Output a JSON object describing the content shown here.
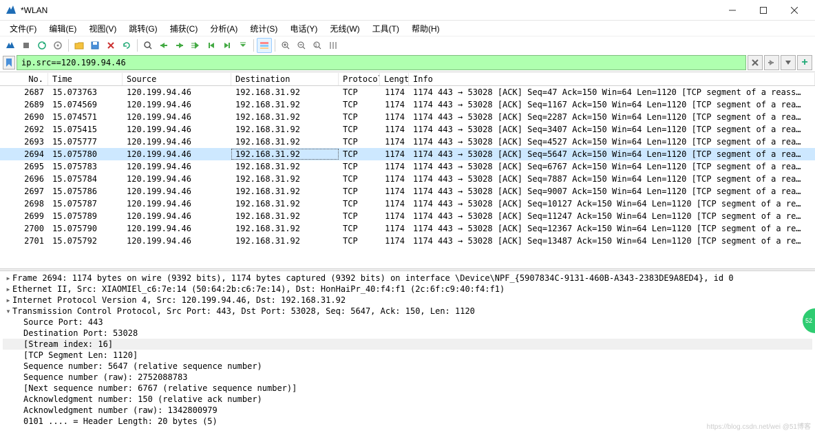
{
  "window": {
    "title": "*WLAN"
  },
  "menus": [
    "文件(F)",
    "编辑(E)",
    "视图(V)",
    "跳转(G)",
    "捕获(C)",
    "分析(A)",
    "统计(S)",
    "电话(Y)",
    "无线(W)",
    "工具(T)",
    "帮助(H)"
  ],
  "filter": {
    "value": "ip.src==120.199.94.46"
  },
  "columns": {
    "no": "No.",
    "time": "Time",
    "source": "Source",
    "destination": "Destination",
    "protocol": "Protocol",
    "length": "Length",
    "info": "Info"
  },
  "selected_no": 2694,
  "packets": [
    {
      "no": 2687,
      "time": "15.073763",
      "src": "120.199.94.46",
      "dst": "192.168.31.92",
      "proto": "TCP",
      "len": 1174,
      "info": "443 → 53028 [ACK] Seq=47 Ack=150 Win=64 Len=1120 [TCP segment of a reass…"
    },
    {
      "no": 2689,
      "time": "15.074569",
      "src": "120.199.94.46",
      "dst": "192.168.31.92",
      "proto": "TCP",
      "len": 1174,
      "info": "443 → 53028 [ACK] Seq=1167 Ack=150 Win=64 Len=1120 [TCP segment of a rea…"
    },
    {
      "no": 2690,
      "time": "15.074571",
      "src": "120.199.94.46",
      "dst": "192.168.31.92",
      "proto": "TCP",
      "len": 1174,
      "info": "443 → 53028 [ACK] Seq=2287 Ack=150 Win=64 Len=1120 [TCP segment of a rea…"
    },
    {
      "no": 2692,
      "time": "15.075415",
      "src": "120.199.94.46",
      "dst": "192.168.31.92",
      "proto": "TCP",
      "len": 1174,
      "info": "443 → 53028 [ACK] Seq=3407 Ack=150 Win=64 Len=1120 [TCP segment of a rea…"
    },
    {
      "no": 2693,
      "time": "15.075777",
      "src": "120.199.94.46",
      "dst": "192.168.31.92",
      "proto": "TCP",
      "len": 1174,
      "info": "443 → 53028 [ACK] Seq=4527 Ack=150 Win=64 Len=1120 [TCP segment of a rea…"
    },
    {
      "no": 2694,
      "time": "15.075780",
      "src": "120.199.94.46",
      "dst": "192.168.31.92",
      "proto": "TCP",
      "len": 1174,
      "info": "443 → 53028 [ACK] Seq=5647 Ack=150 Win=64 Len=1120 [TCP segment of a rea…"
    },
    {
      "no": 2695,
      "time": "15.075783",
      "src": "120.199.94.46",
      "dst": "192.168.31.92",
      "proto": "TCP",
      "len": 1174,
      "info": "443 → 53028 [ACK] Seq=6767 Ack=150 Win=64 Len=1120 [TCP segment of a rea…"
    },
    {
      "no": 2696,
      "time": "15.075784",
      "src": "120.199.94.46",
      "dst": "192.168.31.92",
      "proto": "TCP",
      "len": 1174,
      "info": "443 → 53028 [ACK] Seq=7887 Ack=150 Win=64 Len=1120 [TCP segment of a rea…"
    },
    {
      "no": 2697,
      "time": "15.075786",
      "src": "120.199.94.46",
      "dst": "192.168.31.92",
      "proto": "TCP",
      "len": 1174,
      "info": "443 → 53028 [ACK] Seq=9007 Ack=150 Win=64 Len=1120 [TCP segment of a rea…"
    },
    {
      "no": 2698,
      "time": "15.075787",
      "src": "120.199.94.46",
      "dst": "192.168.31.92",
      "proto": "TCP",
      "len": 1174,
      "info": "443 → 53028 [ACK] Seq=10127 Ack=150 Win=64 Len=1120 [TCP segment of a re…"
    },
    {
      "no": 2699,
      "time": "15.075789",
      "src": "120.199.94.46",
      "dst": "192.168.31.92",
      "proto": "TCP",
      "len": 1174,
      "info": "443 → 53028 [ACK] Seq=11247 Ack=150 Win=64 Len=1120 [TCP segment of a re…"
    },
    {
      "no": 2700,
      "time": "15.075790",
      "src": "120.199.94.46",
      "dst": "192.168.31.92",
      "proto": "TCP",
      "len": 1174,
      "info": "443 → 53028 [ACK] Seq=12367 Ack=150 Win=64 Len=1120 [TCP segment of a re…"
    },
    {
      "no": 2701,
      "time": "15.075792",
      "src": "120.199.94.46",
      "dst": "192.168.31.92",
      "proto": "TCP",
      "len": 1174,
      "info": "443 → 53028 [ACK] Seq=13487 Ack=150 Win=64 Len=1120 [TCP segment of a re…"
    }
  ],
  "details": [
    {
      "caret": ">",
      "indent": 0,
      "text": "Frame 2694: 1174 bytes on wire (9392 bits), 1174 bytes captured (9392 bits) on interface \\Device\\NPF_{5907834C-9131-460B-A343-2383DE9A8ED4}, id 0"
    },
    {
      "caret": ">",
      "indent": 0,
      "text": "Ethernet II, Src: XIAOMIEl_c6:7e:14 (50:64:2b:c6:7e:14), Dst: HonHaiPr_40:f4:f1 (2c:6f:c9:40:f4:f1)"
    },
    {
      "caret": ">",
      "indent": 0,
      "text": "Internet Protocol Version 4, Src: 120.199.94.46, Dst: 192.168.31.92"
    },
    {
      "caret": "v",
      "indent": 0,
      "text": "Transmission Control Protocol, Src Port: 443, Dst Port: 53028, Seq: 5647, Ack: 150, Len: 1120"
    },
    {
      "caret": "",
      "indent": 1,
      "text": "Source Port: 443"
    },
    {
      "caret": "",
      "indent": 1,
      "text": "Destination Port: 53028"
    },
    {
      "caret": "",
      "indent": 1,
      "text": "[Stream index: 16]",
      "hl": true
    },
    {
      "caret": "",
      "indent": 1,
      "text": "[TCP Segment Len: 1120]"
    },
    {
      "caret": "",
      "indent": 1,
      "text": "Sequence number: 5647    (relative sequence number)"
    },
    {
      "caret": "",
      "indent": 1,
      "text": "Sequence number (raw): 2752088783"
    },
    {
      "caret": "",
      "indent": 1,
      "text": "[Next sequence number: 6767    (relative sequence number)]"
    },
    {
      "caret": "",
      "indent": 1,
      "text": "Acknowledgment number: 150    (relative ack number)"
    },
    {
      "caret": "",
      "indent": 1,
      "text": "Acknowledgment number (raw): 1342800979"
    },
    {
      "caret": "",
      "indent": 1,
      "text": "0101 .... = Header Length: 20 bytes (5)"
    }
  ],
  "watermark": "https://blog.csdn.net/wei @51博客",
  "sidebadge": "52"
}
